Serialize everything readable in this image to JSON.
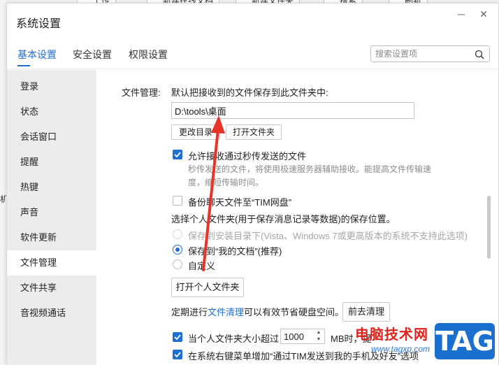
{
  "background": {
    "toolbar": [
      "上传",
      "新建在线文档",
      "新建文件夹",
      "搜索",
      "刷新"
    ],
    "edge_char": "机"
  },
  "window": {
    "title": "系统设置",
    "minimize_glyph": "─",
    "close_glyph": "✕"
  },
  "tabs": [
    {
      "label": "基本设置",
      "active": true
    },
    {
      "label": "安全设置",
      "active": false
    },
    {
      "label": "权限设置",
      "active": false
    }
  ],
  "search": {
    "placeholder": "搜索设置项"
  },
  "sidebar": {
    "items": [
      {
        "label": "登录"
      },
      {
        "label": "状态"
      },
      {
        "label": "会话窗口"
      },
      {
        "label": "提醒"
      },
      {
        "label": "热键"
      },
      {
        "label": "声音"
      },
      {
        "label": "软件更新"
      },
      {
        "label": "文件管理",
        "active": true
      },
      {
        "label": "文件共享"
      },
      {
        "label": "音视频通话"
      }
    ]
  },
  "file_mgmt": {
    "section_label": "文件管理:",
    "default_save_text": "默认把接收到的文件保存到此文件夹中:",
    "path_value": "D:\\tools\\桌面",
    "change_dir_button": "更改目录",
    "open_folder_button": "打开文件夹",
    "allow_flash_label": "允许接收通过秒传发送的文件",
    "allow_flash_checked": true,
    "allow_flash_desc_1": "秒传发送的文件，将使用极速服务器辅助接收。能提高文件传输速",
    "allow_flash_desc_2": "度，缩短传输时间。",
    "backup_label": "备份聊天文件至“TIM网盘”",
    "backup_checked": false,
    "personal_folder_text": "选择个人文件夹(用于保存消息记录等数据)的保存位置。",
    "radio_install_dir": "保存到安装目录下(Vista、Windows 7或更高版本的系统不支持此选项)",
    "radio_my_docs": "保存到“我的文档”(推荐)",
    "radio_custom": "自定义",
    "selected_radio": "my_docs",
    "open_personal_folder_button": "打开个人文件夹",
    "cleanup_prefix": "定期进行",
    "cleanup_link": "文件清理",
    "cleanup_suffix": "可以有效节省硬盘空间。",
    "go_cleanup_button": "前去清理",
    "size_limit_prefix": "当个人文件夹大小超过",
    "size_limit_value": "1000",
    "size_limit_suffix": "MB时，提",
    "size_limit_checked": true,
    "context_menu_label": "在系统右键菜单增加“通过TIM发送到我的手机及好友”选项",
    "context_menu_checked": true
  },
  "watermark": {
    "title": "电脑技术网",
    "url": "www.tagxp.com",
    "badge": "TAG"
  },
  "colors": {
    "accent": "#1f6fd1",
    "arrow": "#e8332a",
    "sidebar_bg": "#ececec"
  }
}
